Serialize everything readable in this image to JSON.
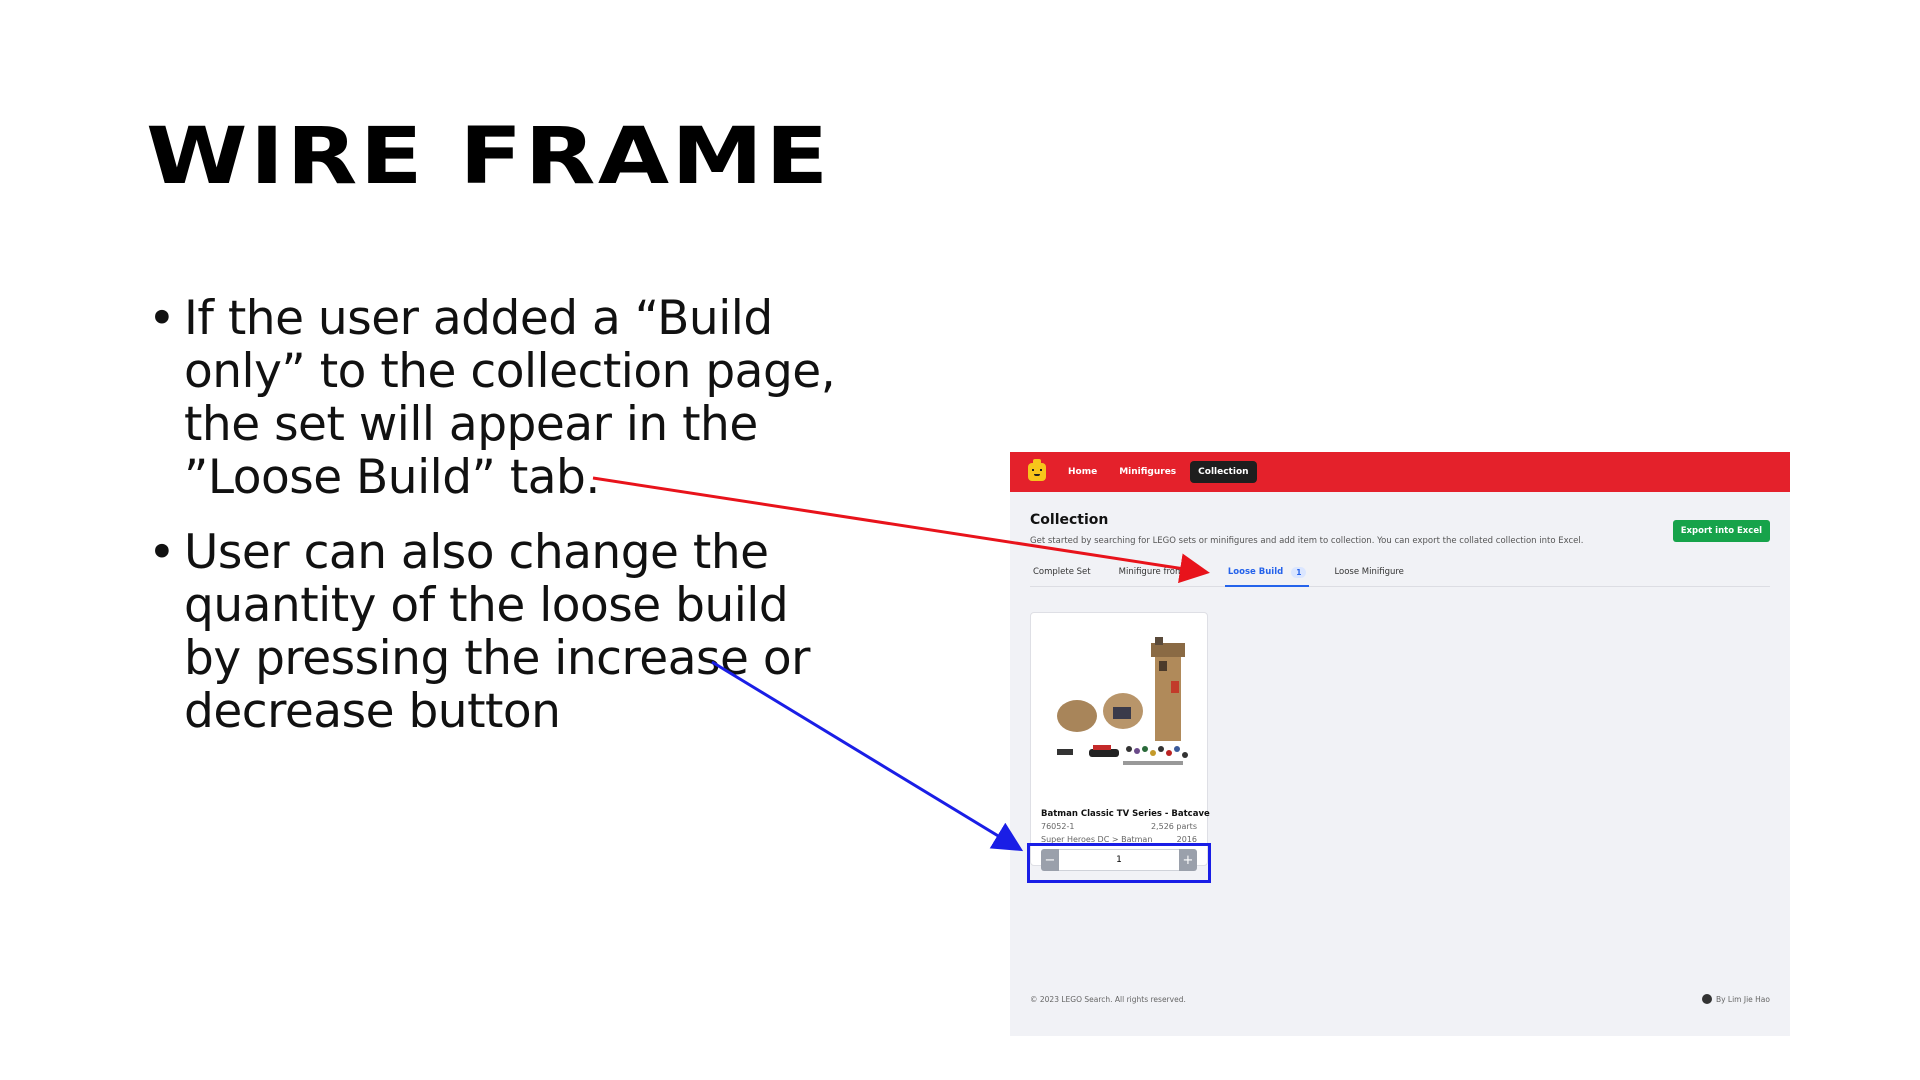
{
  "slide": {
    "title": "Wire Frame",
    "bullets": [
      "If the user added a “Build only” to the collection page, the set will appear in the ”Loose Build” tab.",
      "User can also change the quantity of the loose build by pressing the increase or decrease button"
    ],
    "bullet_glyph": "•"
  },
  "app": {
    "accent_color": "#e4212b",
    "nav": {
      "logo": "lego-head-icon",
      "items": [
        "Home",
        "Minifigures",
        "Collection"
      ],
      "active": "Collection"
    },
    "page_title": "Collection",
    "description": "Get started by searching for LEGO sets or minifigures and add item to collection. You can export the collated collection into Excel.",
    "export_button": "Export into Excel",
    "tabs": [
      {
        "label": "Complete Set"
      },
      {
        "label": "Minifigure from Set"
      },
      {
        "label": "Loose Build",
        "badge": "1",
        "active": true
      },
      {
        "label": "Loose Minifigure"
      }
    ],
    "card": {
      "name": "Batman Classic TV Series - Batcave",
      "set_number": "76052-1",
      "parts": "2,526 parts",
      "theme": "Super Heroes DC > Batman",
      "year": "2016",
      "quantity": "1",
      "decrease_label": "−",
      "increase_label": "+"
    },
    "footer": {
      "copyright": "© 2023 LEGO Search. All rights reserved.",
      "author": "By Lim Jie Hao",
      "author_icon": "github-icon"
    }
  },
  "annotations": {
    "red_arrow_color": "#e8131b",
    "blue_arrow_color": "#1a1ee6"
  }
}
